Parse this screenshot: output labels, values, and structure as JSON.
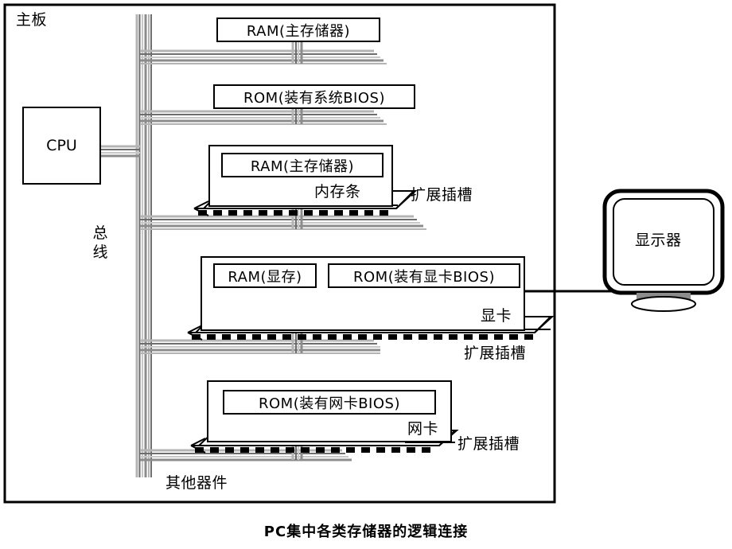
{
  "caption": "PC集中各类存储器的逻辑连接",
  "motherboard": {
    "label": "主板",
    "bus_label_chars": [
      "总",
      "线"
    ],
    "other_components_label": "其他器件"
  },
  "cpu": {
    "label": "CPU"
  },
  "components": {
    "ram_main_onboard": "RAM(主存储器)",
    "rom_system_bios": "ROM(装有系统BIOS)",
    "ram_module": "RAM(主存储器)",
    "memory_module_label": "内存条",
    "ram_vram": "RAM(显存)",
    "rom_vga_bios": "ROM(装有显卡BIOS)",
    "video_card_label": "显卡",
    "rom_nic_bios": "ROM(装有网卡BIOS)",
    "nic_label": "网卡"
  },
  "slots": {
    "slot_memory": "扩展插槽",
    "slot_video": "扩展插槽",
    "slot_nic": "扩展插槽"
  },
  "monitor": {
    "label": "显示器"
  },
  "colors": {
    "stroke": "#000000",
    "background": "#ffffff",
    "bus_light": "#c8c8c8",
    "bus_mid": "#9a9a9a",
    "bus_dark": "#6e6e6e"
  }
}
